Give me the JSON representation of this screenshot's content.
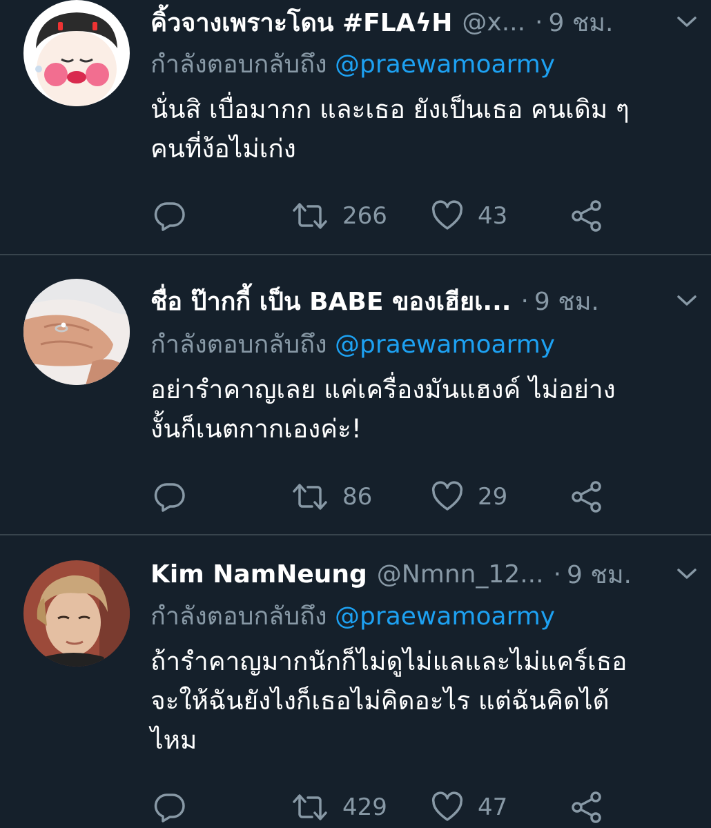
{
  "tweets": [
    {
      "name": "คิ้วจางเพราะโดน #FLAϟH",
      "handle": "@x...",
      "time": "9 ชม.",
      "reply_prefix": "กำลังตอบกลับถึง",
      "reply_to": "@praewamoarmy",
      "body_lines": [
        "นั่นสิ เบื่อมากก และเธอ ยังเป็นเธอ คนเดิม ๆ",
        "คนที่ง้อไม่เก่ง"
      ],
      "retweets": "266",
      "likes": "43",
      "avatar_icon": "cartoon-face-avatar"
    },
    {
      "name": "ชื่อ ป๊ากกี้ เป็น BABE ของเฮียเ...",
      "handle": "",
      "time": "9 ชม.",
      "reply_prefix": "กำลังตอบกลับถึง",
      "reply_to": "@praewamoarmy",
      "body_lines": [
        "อย่ารำคาญเลย แค่เครื่องมันแฮงค์ ไม่อย่าง",
        "งั้นก็เนตกากเองค่ะ!"
      ],
      "retweets": "86",
      "likes": "29",
      "avatar_icon": "ring-hand-avatar"
    },
    {
      "name": "Kim NamNeung",
      "handle": "@Nmnn_12...",
      "time": "9 ชม.",
      "reply_prefix": "กำลังตอบกลับถึง",
      "reply_to": "@praewamoarmy",
      "body_lines": [
        "ถ้ารำคาญมากนักก็ไม่ดูไม่แลและไม่แคร์เธอ",
        "จะให้ฉันยังไงก็เธอไม่คิดอะไร แต่ฉันคิดได้",
        "ไหม"
      ],
      "retweets": "429",
      "likes": "47",
      "avatar_icon": "portrait-photo-avatar"
    }
  ],
  "icons": {
    "reply": "reply-icon",
    "retweet": "retweet-icon",
    "like": "heart-icon",
    "share": "share-icon",
    "more": "chevron-down-icon"
  },
  "colors": {
    "background": "#15202b",
    "divider": "#38444d",
    "primary_text": "#ffffff",
    "secondary_text": "#8899a6",
    "mention": "#1da1f2"
  }
}
